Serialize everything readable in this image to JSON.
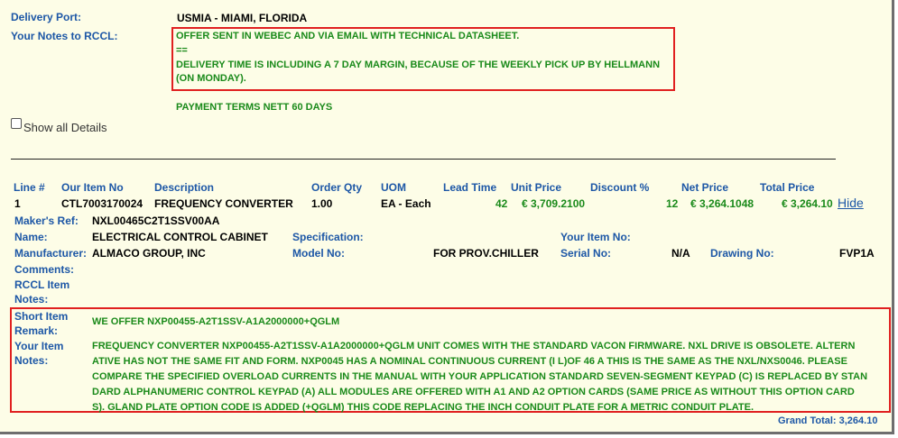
{
  "header": {
    "delivery_port_label": "Delivery Port:",
    "delivery_port_value": "USMIA - MIAMI, FLORIDA",
    "notes_label": "Your Notes to RCCL:",
    "notes_lines": [
      "OFFER SENT IN WEBEC AND VIA EMAIL WITH TECHNICAL DATASHEET.",
      "==",
      "DELIVERY TIME IS INCLUDING A 7 DAY MARGIN, BECAUSE OF THE WEEKLY PICK UP BY HELLMANN",
      "(ON MONDAY)."
    ],
    "payment_terms": "PAYMENT TERMS NETT 60 DAYS",
    "show_all_label": "Show all Details"
  },
  "table": {
    "columns": [
      "Line #",
      "Our Item No",
      "Description",
      "Order Qty",
      "UOM",
      "Lead Time",
      "Unit Price",
      "Discount %",
      "Net Price",
      "Total Price"
    ],
    "row": {
      "line": "1",
      "item_no": "CTL7003170024",
      "description": "FREQUENCY CONVERTER",
      "qty": "1.00",
      "uom": "EA - Each",
      "lead_time": "42",
      "unit_price": "€ 3,709.2100",
      "discount": "12",
      "net_price": "€ 3,264.1048",
      "total_price": "€ 3,264.10",
      "hide_label": "Hide"
    }
  },
  "details": {
    "makers_ref_label": "Maker's Ref:",
    "makers_ref": "NXL00465C2T1SSV00AA",
    "name_label": "Name:",
    "name": "ELECTRICAL CONTROL CABINET",
    "specification_label": "Specification:",
    "your_item_no_label": "Your Item No:",
    "manufacturer_label": "Manufacturer:",
    "manufacturer": "ALMACO GROUP, INC",
    "model_no_label": "Model No:",
    "model_no": "FOR PROV.CHILLER",
    "serial_no_label": "Serial No:",
    "serial_no": "N/A",
    "drawing_no_label": "Drawing No:",
    "drawing_no": "FVP1A",
    "comments_label": "Comments:",
    "rccl_item_notes_label_1": "RCCL Item",
    "rccl_item_notes_label_2": "Notes:",
    "short_remark_label_1": "Short Item",
    "short_remark_label_2": "Remark:",
    "short_remark": "WE OFFER NXP00455-A2T1SSV-A1A2000000+QGLM",
    "your_item_notes_label_1": "Your Item",
    "your_item_notes_label_2": "Notes:",
    "your_item_notes_lines": [
      "FREQUENCY CONVERTER NXP00455-A2T1SSV-A1A2000000+QGLM UNIT COMES WITH THE STANDARD VACON FIRMWARE. NXL DRIVE IS OBSOLETE. ALTERN",
      "ATIVE HAS NOT THE SAME FIT AND FORM. NXP0045 HAS A NOMINAL CONTINUOUS CURRENT (I L)OF 46 A THIS IS THE SAME AS THE NXL/NXS0046. PLEASE",
      "COMPARE THE SPECIFIED OVERLOAD CURRENTS IN THE MANUAL WITH YOUR APPLICATION STANDARD SEVEN-SEGMENT KEYPAD (C) IS REPLACED BY STAN",
      "DARD ALPHANUMERIC CONTROL KEYPAD (A) ALL MODULES ARE OFFERED WITH A1 AND A2 OPTION CARDS (SAME PRICE AS WITHOUT THIS OPTION CARD",
      "S). GLAND PLATE OPTION CODE IS ADDED (+QGLM) THIS CODE REPLACING THE INCH CONDUIT PLATE FOR A METRIC CONDUIT PLATE."
    ]
  },
  "footer": {
    "grand_total": "Grand Total: 3,264.10"
  },
  "colors": {
    "label_blue": "#1d57a6",
    "note_green": "#1a8a1a",
    "highlight_red": "#e02020",
    "background": "#fdfde7"
  }
}
